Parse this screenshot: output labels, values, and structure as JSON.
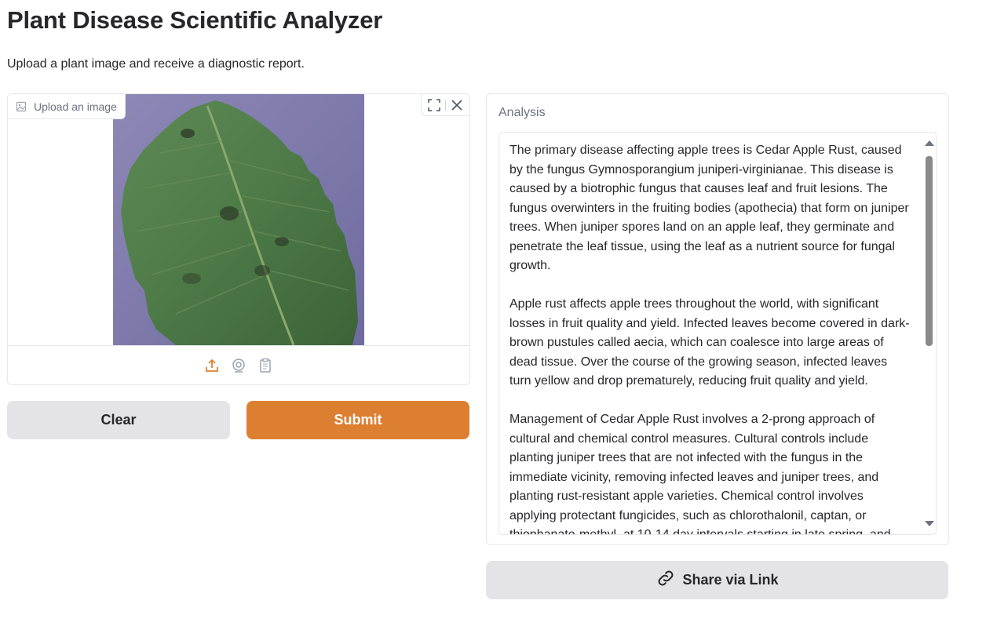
{
  "header": {
    "title": "Plant Disease Scientific Analyzer",
    "subtitle": "Upload a plant image and receive a diagnostic report."
  },
  "image_input": {
    "label": "Upload an image",
    "label_icon": "image-icon",
    "image_description": "green apple leaf with dark lesions on purple background",
    "actions": [
      "fullscreen-icon",
      "close-icon"
    ],
    "sources": [
      "upload-icon",
      "webcam-icon",
      "clipboard-icon"
    ]
  },
  "buttons": {
    "clear": "Clear",
    "submit": "Submit",
    "share": "Share via Link"
  },
  "analysis": {
    "label": "Analysis",
    "paragraphs": [
      "The primary disease affecting apple trees is Cedar Apple Rust, caused by the fungus Gymnosporangium juniperi-virginianae. This disease is caused by a biotrophic fungus that causes leaf and fruit lesions. The fungus overwinters in the fruiting bodies (apothecia) that form on juniper trees. When juniper spores land on an apple leaf, they germinate and penetrate the leaf tissue, using the leaf as a nutrient source for fungal growth.",
      "Apple rust affects apple trees throughout the world, with significant losses in fruit quality and yield. Infected leaves become covered in dark-brown pustules called aecia, which can coalesce into large areas of dead tissue. Over the course of the growing season, infected leaves turn yellow and drop prematurely, reducing fruit quality and yield.",
      "Management of Cedar Apple Rust involves a 2-prong approach of cultural and chemical control measures. Cultural controls include planting juniper trees that are not infected with the fungus in the immediate vicinity, removing infected leaves and juniper trees, and planting rust-resistant apple varieties. Chemical control involves applying protectant fungicides, such as chlorothalonil, captan, or thiophanate-methyl, at 10-14 day intervals starting in late spring, and"
    ]
  },
  "colors": {
    "accent": "#dd7f30",
    "secondary_button": "#e4e4e7",
    "border": "#e5e7eb"
  }
}
